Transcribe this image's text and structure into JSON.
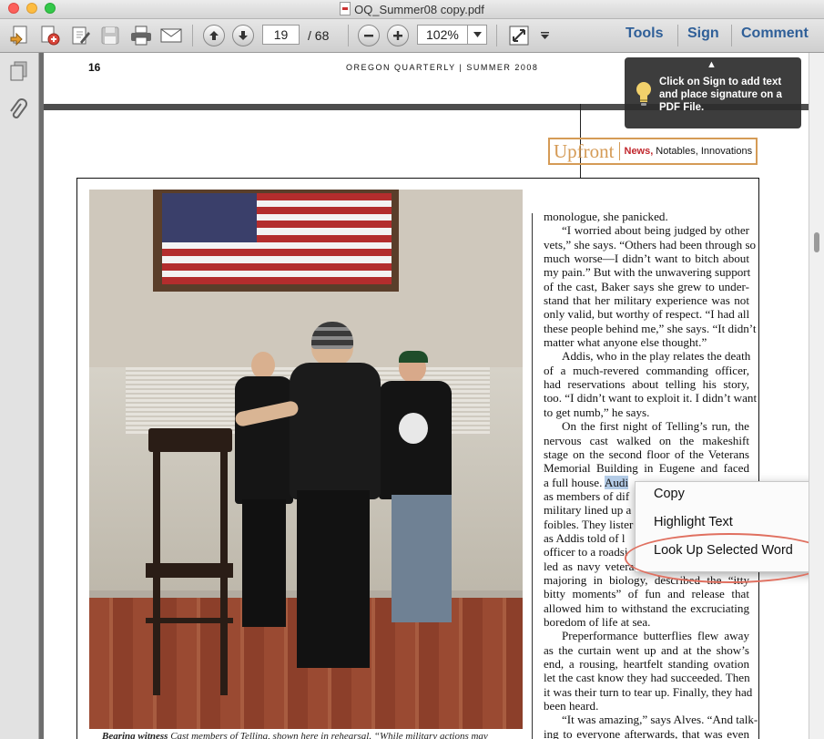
{
  "window": {
    "title": "OQ_Summer08 copy.pdf"
  },
  "toolbar": {
    "page_current": "19",
    "page_total": "/ 68",
    "zoom": "102%",
    "tools_label": "Tools",
    "sign_label": "Sign",
    "comment_label": "Comment"
  },
  "page": {
    "number": "16",
    "running_head": "OREGON QUARTERLY | SUMMER 2008",
    "logo": {
      "up": "Upfront",
      "news": "News,",
      "rest": "Notables, Innovations"
    }
  },
  "tooltip": {
    "text": "Click on Sign to add text and place signature on a PDF File."
  },
  "context_menu": {
    "copy": "Copy",
    "highlight": "Highlight Text",
    "lookup": "Look Up Selected Word"
  },
  "article": {
    "lines": [
      "monologue, she panicked.",
      "“I worried about being judged by other",
      "vets,” she says. “Others had been through so",
      "much worse—I didn’t want to bitch about",
      "my pain.” But with the unwavering support",
      "of the cast, Baker says she grew to under-",
      "stand that her military experience was not",
      "only valid, but worthy of respect. “I had all",
      "these people behind me,” she says. “It didn’t",
      "matter what anyone else thought.”",
      "Addis, who in the play relates the death",
      "of a much-revered commanding officer,",
      "had reservations about telling his story,",
      "too. “I didn’t want to exploit it. I didn’t want",
      "to get numb,” he says.",
      "On the first night of Telling’s run, the",
      "nervous cast walked on the makeshift",
      "stage on the second floor of the Veterans",
      "Memorial Building in Eugene and faced",
      "a full house. ",
      "as members of dif",
      "military lined up a",
      "foibles. They lister",
      "as Addis told of l",
      "officer to a roadsi",
      "led as navy veteran Jason Alves, a senior",
      "majoring in biology, described the “itty",
      "bitty moments” of fun and release that",
      "allowed him to withstand the excruciating",
      "boredom of life at sea.",
      "Preperformance butterflies flew away",
      "as the curtain went up and at the show’s",
      "end, a rousing, heartfelt standing ovation",
      "let the cast know they had succeeded. Then",
      "it was their turn to tear up. Finally, they had",
      "been heard.",
      "“It was amazing,” says Alves. “And talk-",
      "ing to everyone afterwards, that was even"
    ],
    "selected_word": "Audi"
  },
  "caption": {
    "bold": "Bearing witness",
    "text": " Cast members of Telling, shown here in rehearsal. “While military actions may"
  },
  "icons": {
    "bulb": "lightbulb-icon"
  }
}
